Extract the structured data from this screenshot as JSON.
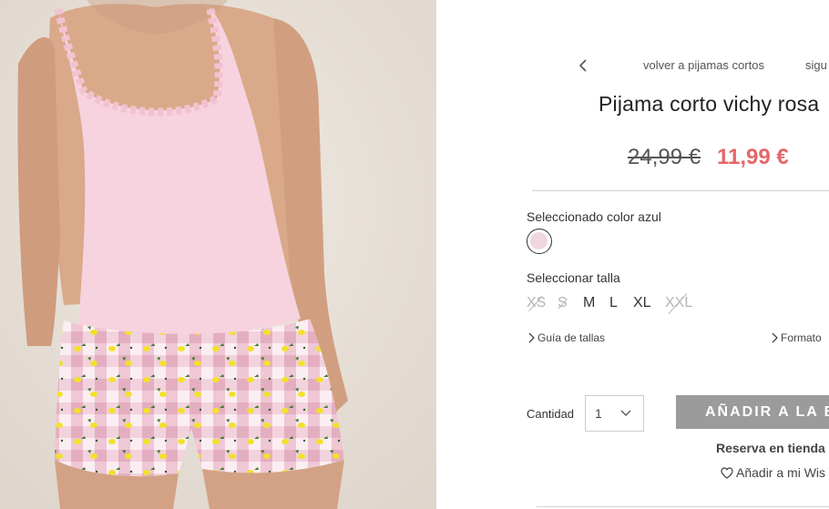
{
  "nav": {
    "prev_icon": "chevron-left-icon",
    "back_label": "volver a pijamas cortos",
    "next_label": "sigu"
  },
  "product": {
    "title": "Pijama corto vichy rosa",
    "old_price": "24,99 €",
    "new_price": "11,99 €",
    "color_label": "Seleccionado color azul",
    "swatch_color": "#efd6df",
    "size_label": "Seleccionar talla",
    "sizes": [
      {
        "label": "XS",
        "available": false
      },
      {
        "label": "S",
        "available": false
      },
      {
        "label": "M",
        "available": true
      },
      {
        "label": "L",
        "available": true
      },
      {
        "label": "XL",
        "available": true
      },
      {
        "label": "XXL",
        "available": false
      }
    ],
    "size_guide_label": "Guía de tallas",
    "format_label": "Formato"
  },
  "purchase": {
    "quantity_label": "Cantidad",
    "quantity_value": "1",
    "add_to_bag_label": "AÑADIR A LA B",
    "reserve_label": "Reserva en tienda f",
    "wishlist_label": "Añadir a mi Wis",
    "wishlist_icon": "heart-icon"
  },
  "colors": {
    "sale_price": "#e5676a",
    "button_bg": "#9b9b9b",
    "swatch_selected": "#efd6df"
  }
}
